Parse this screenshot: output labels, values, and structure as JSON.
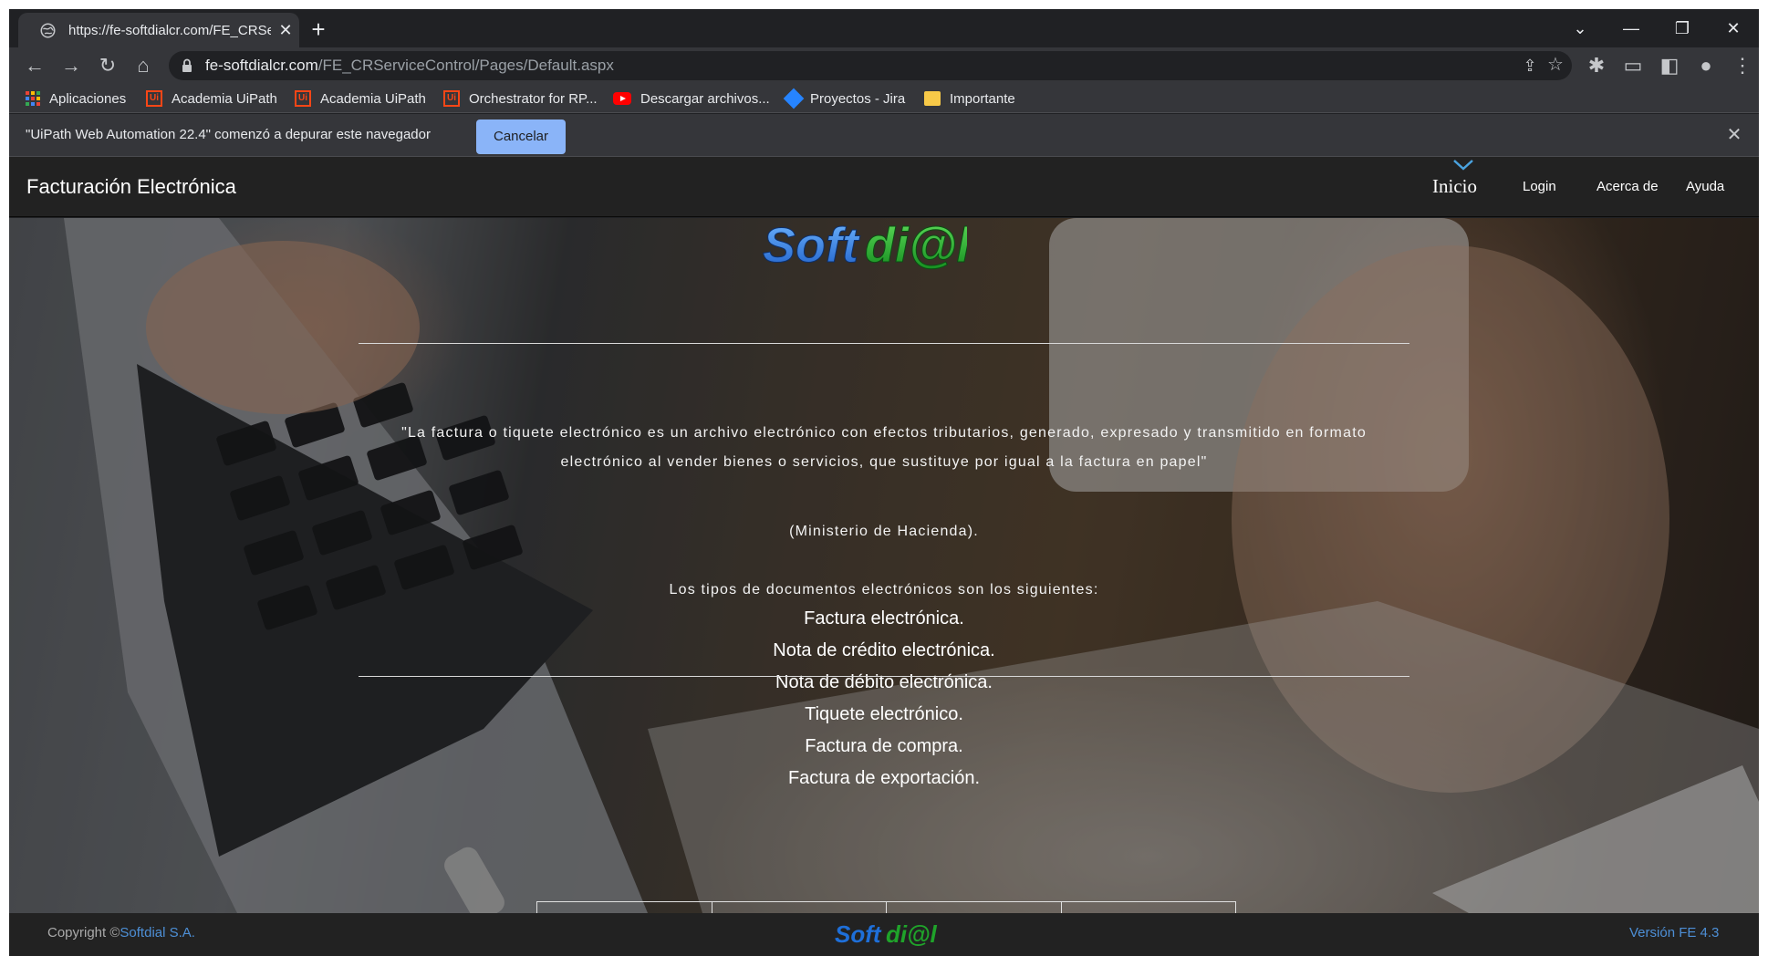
{
  "browser": {
    "tab": {
      "title": "https://fe-softdialcr.com/FE_CRSe",
      "close_glyph": "✕",
      "icon": "globe-icon"
    },
    "new_tab_glyph": "+",
    "window_controls": {
      "tabsearch": "⌄",
      "minimize": "—",
      "restore": "❐",
      "close": "✕"
    },
    "url": {
      "host": "fe-softdialcr.com",
      "path": "/FE_CRServiceControl/Pages/Default.aspx"
    },
    "nav_glyphs": {
      "back": "←",
      "forward": "→",
      "reload": "↻",
      "home": "⌂",
      "share": "⇪",
      "star": "☆",
      "extensions": "✱",
      "cast": "▭",
      "sidepanel": "◧",
      "profile": "●",
      "menu": "⋮"
    },
    "bookmarks": [
      {
        "label": "Aplicaciones",
        "icon": "apps-grid-icon"
      },
      {
        "label": "Academia UiPath",
        "icon": "uipath-icon"
      },
      {
        "label": "Academia UiPath",
        "icon": "uipath-icon"
      },
      {
        "label": "Orchestrator for RP...",
        "icon": "uipath-icon"
      },
      {
        "label": "Descargar archivos...",
        "icon": "youtube-icon"
      },
      {
        "label": "Proyectos - Jira",
        "icon": "jira-icon"
      },
      {
        "label": "Importante",
        "icon": "folder-icon"
      }
    ],
    "infobar": {
      "message": "\"UiPath Web Automation 22.4\" comenzó a depurar este navegador",
      "cancel_label": "Cancelar",
      "close_glyph": "✕"
    }
  },
  "site": {
    "brand": "Facturación Electrónica",
    "nav": {
      "home": "Inicio",
      "login": "Login",
      "about": "Acerca de",
      "help": "Ayuda"
    },
    "logo_text": "Softdi@l",
    "quote": "\"La factura o tiquete electrónico es un archivo electrónico con efectos tributarios, generado, expresado y transmitido en formato electrónico al vender bienes o servicios, que sustituye por igual a la factura en papel\"",
    "quote_source": "(Ministerio de Hacienda).",
    "docs_intro": "Los tipos de documentos electrónicos son los siguientes:",
    "documents": [
      "Factura electrónica.",
      "Nota de crédito electrónica.",
      "Nota de débito electrónica.",
      "Tiquete electrónico.",
      "Factura de compra.",
      "Factura de exportación."
    ],
    "footer": {
      "copyright_prefix": "Copyright ©",
      "company": "Softdial S.A.",
      "version": "Versión FE 4.3"
    }
  },
  "colors": {
    "accent": "#8ab4f8",
    "logo_blue": "#1e6fd9",
    "logo_green": "#1fa32a",
    "link_blue": "#4d8fd6",
    "chrome_dark": "#202124",
    "chrome_mid": "#35363a"
  }
}
